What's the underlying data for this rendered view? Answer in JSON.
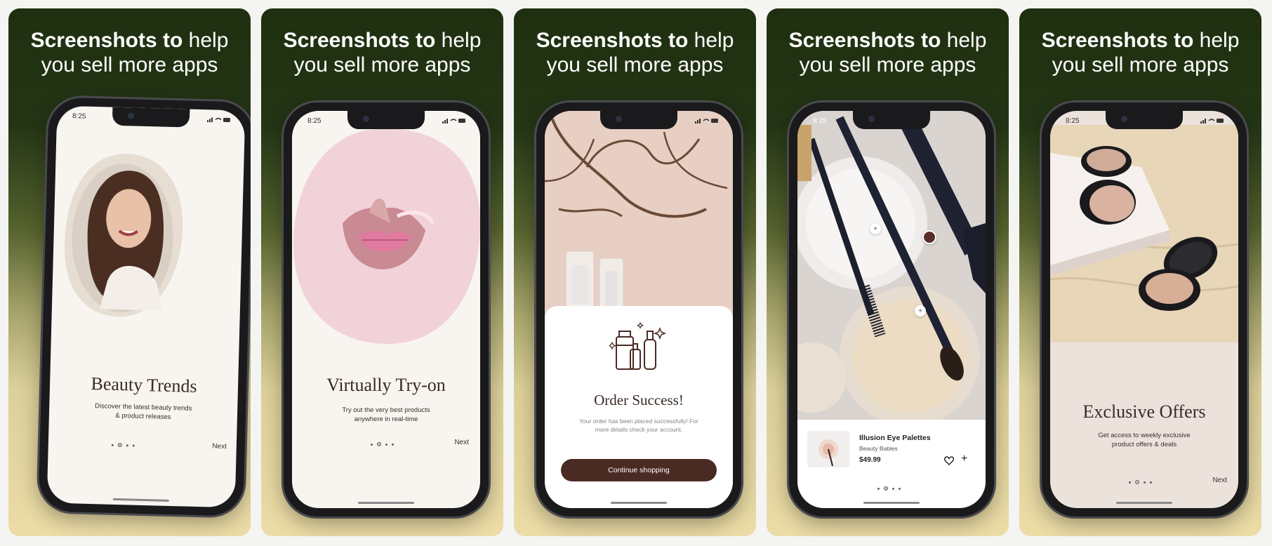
{
  "headline": {
    "bold": "Screenshots to",
    "rest_line1": "help",
    "line2": "you sell more apps"
  },
  "status_time": "8:25",
  "screens": [
    {
      "title": "Beauty Trends",
      "subtitle_line1": "Discover the latest beauty trends",
      "subtitle_line2": "& product releases",
      "next_label": "Next",
      "active_dot": 2
    },
    {
      "title": "Virtually Try-on",
      "subtitle_line1": "Try out the very best products",
      "subtitle_line2": "anywhere in real-time",
      "next_label": "Next",
      "active_dot": 2
    },
    {
      "title": "Order Success!",
      "subtitle_line1": "Your order has been placed successfully! For",
      "subtitle_line2": "more details check your account.",
      "button_label": "Continue shopping"
    },
    {
      "product_name": "Illusion Eye Palettes",
      "product_brand": "Beauty Babies",
      "product_price": "$49.99",
      "add_symbol": "+",
      "active_dot": 2
    },
    {
      "title": "Exclusive Offers",
      "subtitle_line1": "Get access to weekly exclusive",
      "subtitle_line2": "product offers & deals",
      "next_label": "Next",
      "active_dot": 2
    }
  ],
  "colors": {
    "panel_top": "#1f3010",
    "panel_bottom": "#ecdca6",
    "button_brown": "#4a2b24",
    "screen_bg": "#f7f3ee"
  }
}
